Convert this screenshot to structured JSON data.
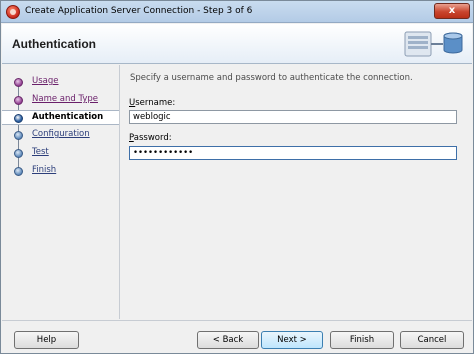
{
  "window": {
    "title": "Create Application Server Connection - Step 3 of 6",
    "close_glyph": "x"
  },
  "header": {
    "title": "Authentication"
  },
  "nav": {
    "items": [
      {
        "label": "Usage",
        "state": "visited"
      },
      {
        "label": "Name and Type",
        "state": "visited"
      },
      {
        "label": "Authentication",
        "state": "current"
      },
      {
        "label": "Configuration",
        "state": "future"
      },
      {
        "label": "Test",
        "state": "future"
      },
      {
        "label": "Finish",
        "state": "future"
      }
    ]
  },
  "form": {
    "instructions": "Specify a username and password to authenticate the connection.",
    "username_label_mn": "U",
    "username_label_rest": "sername:",
    "username_value": "weblogic",
    "password_label_mn": "P",
    "password_label_rest": "assword:",
    "password_mask": "••••••••••••"
  },
  "buttons": {
    "help": "Help",
    "back": "< Back",
    "next": "Next >",
    "finish": "Finish",
    "cancel": "Cancel"
  }
}
